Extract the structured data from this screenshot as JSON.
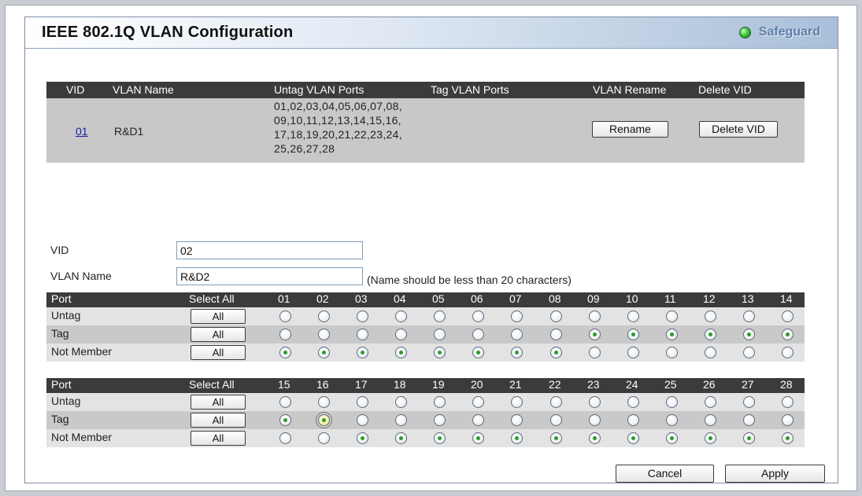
{
  "title": "IEEE 802.1Q VLAN Configuration",
  "safeguard": "Safeguard",
  "vlan_list": {
    "headers": [
      "VID",
      "VLAN Name",
      "Untag VLAN Ports",
      "Tag VLAN Ports",
      "VLAN Rename",
      "Delete VID"
    ],
    "row": {
      "vid": "01",
      "name": "R&D1",
      "untag_ports": "01,02,03,04,05,06,07,08,\n09,10,11,12,13,14,15,16,\n17,18,19,20,21,22,23,24,\n25,26,27,28",
      "tag_ports": "",
      "rename_label": "Rename",
      "delete_label": "Delete VID"
    }
  },
  "form": {
    "vid_label": "VID",
    "vid_value": "02",
    "name_label": "VLAN Name",
    "name_value": "R&D2",
    "name_note": "(Name should be less than 20 characters)"
  },
  "grid": {
    "port_label": "Port",
    "select_all_label": "Select All",
    "row_labels": [
      "Untag",
      "Tag",
      "Not Member"
    ],
    "all_label": "All",
    "groups": [
      {
        "ports": [
          "01",
          "02",
          "03",
          "04",
          "05",
          "06",
          "07",
          "08",
          "09",
          "10",
          "11",
          "12",
          "13",
          "14"
        ],
        "state": [
          "N",
          "N",
          "N",
          "N",
          "N",
          "N",
          "N",
          "N",
          "T",
          "T",
          "T",
          "T",
          "T",
          "T"
        ]
      },
      {
        "ports": [
          "15",
          "16",
          "17",
          "18",
          "19",
          "20",
          "21",
          "22",
          "23",
          "24",
          "25",
          "26",
          "27",
          "28"
        ],
        "state": [
          "T",
          "T",
          "N",
          "N",
          "N",
          "N",
          "N",
          "N",
          "N",
          "N",
          "N",
          "N",
          "N",
          "N"
        ]
      }
    ],
    "focused_port": "16"
  },
  "buttons": {
    "cancel": "Cancel",
    "apply": "Apply"
  }
}
